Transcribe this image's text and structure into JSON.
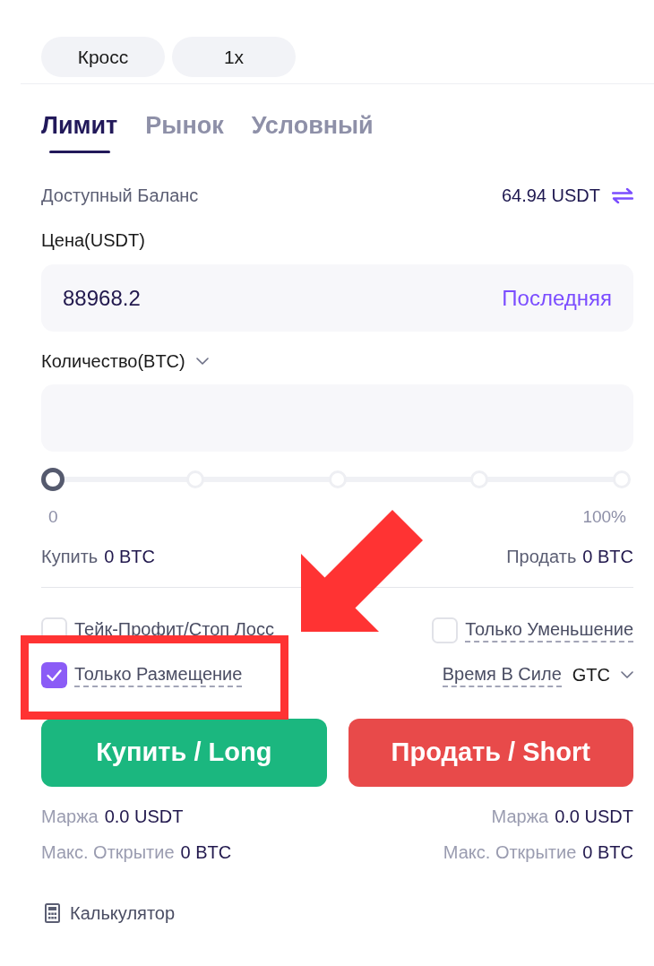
{
  "position_settings": [
    "Кросс",
    "1x"
  ],
  "order_tabs": [
    {
      "label": "Лимит",
      "selected": true
    },
    {
      "label": "Рынок",
      "selected": false
    },
    {
      "label": "Условный",
      "selected": false
    }
  ],
  "balance": {
    "label": "Доступный Баланс",
    "value": "64.94 USDT"
  },
  "price": {
    "label": "Цена(USDT)",
    "value": "88968.2",
    "action": "Последняя"
  },
  "quantity": {
    "label": "Количество(BTC)"
  },
  "slider": {
    "level": 0,
    "min_label": "0",
    "max_label": "100%"
  },
  "amounts": [
    {
      "label": "Купить",
      "value": "0 BTC"
    },
    {
      "label": "Продать",
      "value": "0 BTC"
    }
  ],
  "options": [
    {
      "kind": "checkbox",
      "label": "Тейк-Профит/Стоп Лосс",
      "checked": false
    },
    {
      "kind": "checkbox",
      "label": "Только Уменьшение",
      "checked": false
    },
    {
      "kind": "checkbox",
      "label": "Только Размещение",
      "checked": true
    },
    {
      "kind": "select",
      "label": "Время В Силе",
      "value": "GTC"
    }
  ],
  "actions": [
    {
      "kind": "buy",
      "label": "Купить / Long",
      "details": [
        {
          "label": "Маржа",
          "value": "0.0 USDT"
        },
        {
          "label": "Макс. Открытие",
          "value": "0 BTC"
        }
      ]
    },
    {
      "kind": "sell",
      "label": "Продать / Short",
      "details": [
        {
          "label": "Маржа",
          "value": "0.0 USDT"
        },
        {
          "label": "Макс. Открытие",
          "value": "0 BTC"
        }
      ]
    }
  ],
  "calculator": {
    "label": "Калькулятор"
  }
}
